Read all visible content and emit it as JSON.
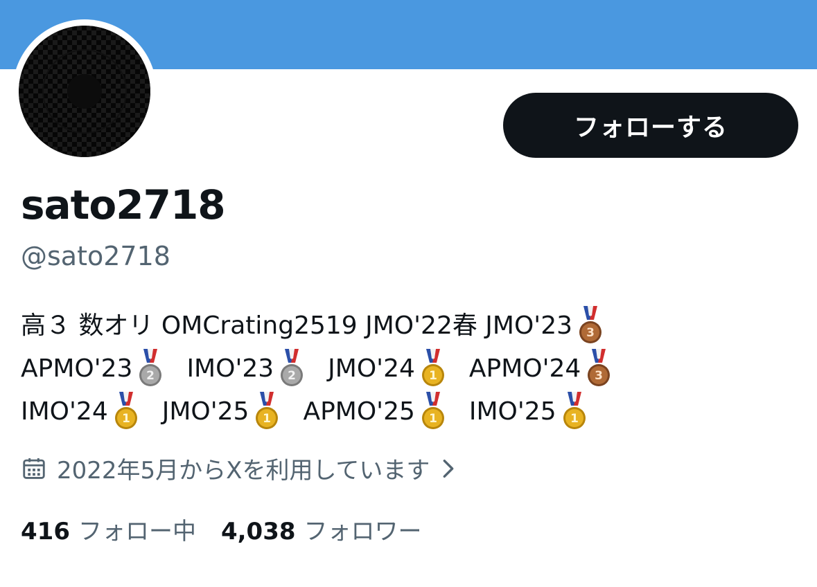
{
  "profile": {
    "display_name": "sato2718",
    "handle": "@sato2718",
    "follow_button_label": "フォローする",
    "bio_lines": [
      [
        {
          "text": "高３ 数オリ OMCrating2519 JMO'22春 JMO'23",
          "medal": "bronze"
        }
      ],
      [
        {
          "text": "APMO'23",
          "medal": "silver"
        },
        {
          "text": "IMO'23",
          "medal": "silver"
        },
        {
          "text": "JMO'24",
          "medal": "gold"
        },
        {
          "text": "APMO'24",
          "medal": "bronze"
        }
      ],
      [
        {
          "text": "IMO'24",
          "medal": "gold"
        },
        {
          "text": "JMO'25",
          "medal": "gold"
        },
        {
          "text": "APMO'25",
          "medal": "gold"
        },
        {
          "text": "IMO'25",
          "medal": "gold"
        }
      ]
    ],
    "joined": "2022年5月からXを利用しています",
    "following_count": "416",
    "following_label": "フォロー中",
    "followers_count": "4,038",
    "followers_label": "フォロワー"
  },
  "icons": {
    "calendar": "calendar-icon",
    "chevron": "chevron-right-icon",
    "medals": [
      "gold-medal-icon",
      "silver-medal-icon",
      "bronze-medal-icon"
    ]
  },
  "colors": {
    "banner": "#4a98e0",
    "button_bg": "#0f1419",
    "secondary_text": "#536471",
    "gold": "#e8b322",
    "silver": "#a9a9a9",
    "bronze": "#b06a36"
  }
}
